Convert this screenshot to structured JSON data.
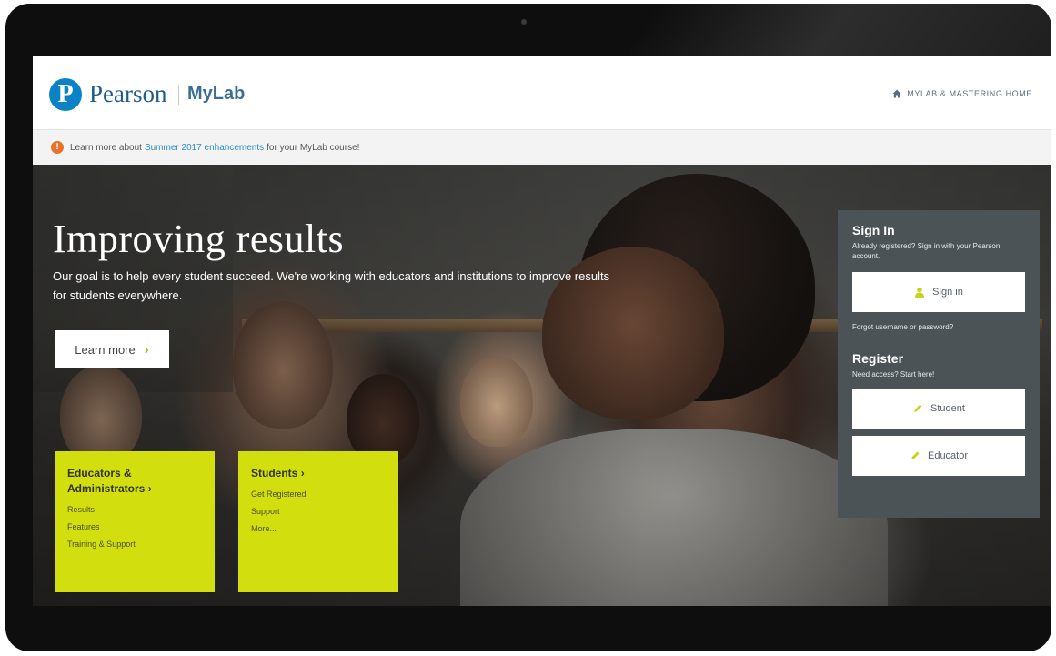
{
  "header": {
    "brand": "Pearson",
    "product": "MyLab",
    "home_link": "MYLAB & MASTERING HOME"
  },
  "notice": {
    "prefix": "Learn more about",
    "link": "Summer 2017 enhancements",
    "suffix": "for your MyLab course!"
  },
  "hero": {
    "title": "Improving results",
    "text": "Our goal is to help every student succeed. We're working with educators and institutions to improve results for students everywhere.",
    "learn_more": "Learn more"
  },
  "educators": {
    "title": "Educators & Administrators",
    "links": [
      "Results",
      "Features",
      "Training & Support"
    ]
  },
  "students": {
    "title": "Students",
    "links": [
      "Get Registered",
      "Support",
      "More..."
    ]
  },
  "signin": {
    "heading": "Sign In",
    "subtext": "Already registered? Sign in with your Pearson account.",
    "button": "Sign in",
    "forgot": "Forgot username or password?"
  },
  "register": {
    "heading": "Register",
    "subtext": "Need access? Start here!",
    "student_button": "Student",
    "educator_button": "Educator"
  },
  "colors": {
    "brand_blue": "#0a82c5",
    "accent_lime": "#d3de0f",
    "panel_gray": "#4b5357",
    "alert_orange": "#e8742b",
    "link_blue": "#2b8cc4"
  }
}
